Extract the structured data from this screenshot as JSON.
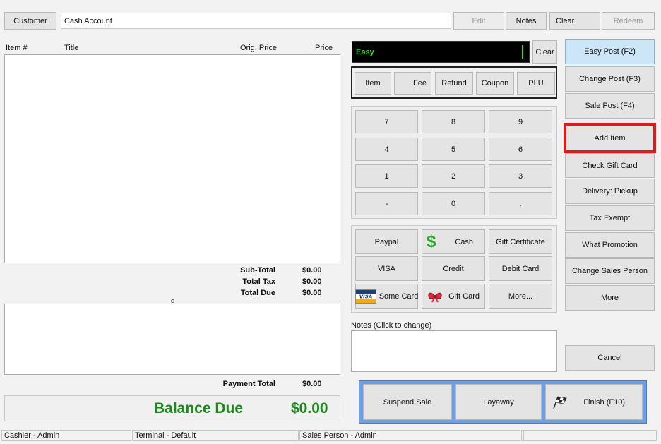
{
  "customer": {
    "button_label": "Customer",
    "account_value": "Cash Account"
  },
  "top_actions": {
    "edit": "Edit",
    "notes": "Notes",
    "clear": "Clear",
    "redeem": "Redeem"
  },
  "items_table": {
    "columns": [
      "Item #",
      "Title",
      "Orig. Price",
      "Price"
    ]
  },
  "totals": {
    "subtotal_label": "Sub-Total",
    "subtotal_value": "$0.00",
    "tax_label": "Total Tax",
    "tax_value": "$0.00",
    "due_label": "Total Due",
    "due_value": "$0.00",
    "payment_total_label": "Payment Total",
    "payment_total_value": "$0.00",
    "balance_due_label": "Balance Due",
    "balance_due_value": "$0.00"
  },
  "entry": {
    "mode_text": "Easy",
    "clear_label": "Clear"
  },
  "entry_types": [
    "Item",
    "Fee",
    "Refund",
    "Coupon",
    "PLU"
  ],
  "keypad": [
    "7",
    "8",
    "9",
    "4",
    "5",
    "6",
    "1",
    "2",
    "3",
    "-",
    "0",
    "."
  ],
  "payments": {
    "paypal": "Paypal",
    "cash": "Cash",
    "gift_certificate": "Gift Certificate",
    "visa": "VISA",
    "credit": "Credit",
    "debit_card": "Debit Card",
    "some_card": "Some Card",
    "gift_card": "Gift Card",
    "more": "More..."
  },
  "notes": {
    "label": "Notes (Click to change)"
  },
  "right_menu": {
    "easy_post": "Easy Post (F2)",
    "change_post": "Change Post (F3)",
    "sale_post": "Sale Post (F4)",
    "add_item": "Add Item",
    "check_gift_card": "Check Gift Card",
    "delivery": "Delivery: Pickup",
    "tax_exempt": "Tax Exempt",
    "what_promotion": "What Promotion",
    "change_sales_person": "Change Sales Person",
    "more": "More",
    "cancel": "Cancel"
  },
  "bottom_actions": {
    "suspend": "Suspend Sale",
    "layaway": "Layaway",
    "finish": "Finish (F10)"
  },
  "status_bar": {
    "cashier": "Cashier - Admin",
    "terminal": "Terminal - Default",
    "sales_person": "Sales Person - Admin",
    "extra1": "",
    "extra2": ""
  },
  "colors": {
    "highlight_border": "#e0191b",
    "balance_green": "#1a8a1a",
    "action_bar_blue": "#6e9ee6",
    "active_blue": "#cde6f7",
    "entry_text_green": "#3bd23b"
  }
}
